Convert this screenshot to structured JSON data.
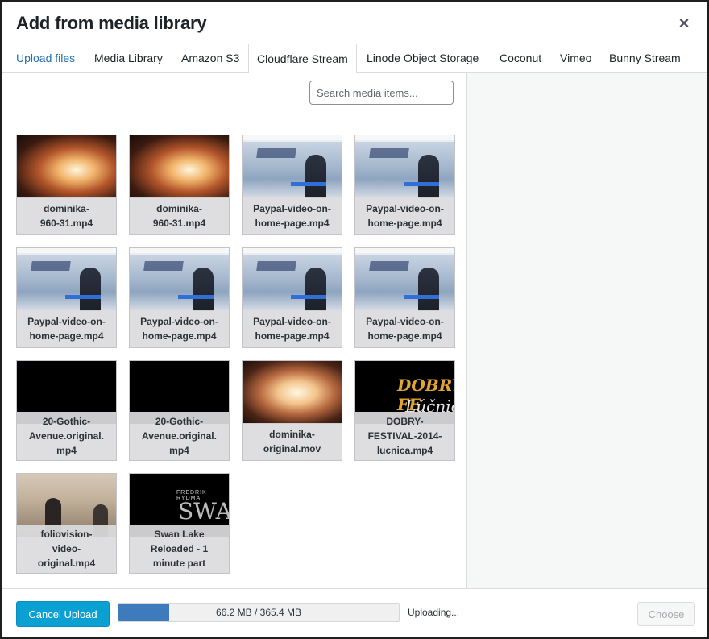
{
  "modal": {
    "title": "Add from media library",
    "close_label": "×"
  },
  "tabs": [
    {
      "label": "Upload files",
      "kind": "link"
    },
    {
      "label": "Media Library"
    },
    {
      "label": "Amazon S3"
    },
    {
      "label": "Cloudflare Stream",
      "active": true
    },
    {
      "label": "Linode Object Storage"
    },
    {
      "label": "Coconut"
    },
    {
      "label": "Vimeo"
    },
    {
      "label": "Bunny Stream"
    }
  ],
  "search": {
    "placeholder": "Search media items..."
  },
  "media_items": [
    {
      "lines": [
        "dominika-",
        "960-31.mp4"
      ],
      "thumb": "fire"
    },
    {
      "lines": [
        "dominika-",
        "960-31.mp4"
      ],
      "thumb": "fire"
    },
    {
      "lines": [
        "Paypal-video-on-",
        "home-page.mp4"
      ],
      "thumb": "site"
    },
    {
      "lines": [
        "Paypal-video-on-",
        "home-page.mp4"
      ],
      "thumb": "site"
    },
    {
      "lines": [
        "Paypal-video-on-",
        "home-page.mp4"
      ],
      "thumb": "site"
    },
    {
      "lines": [
        "Paypal-video-on-",
        "home-page.mp4"
      ],
      "thumb": "site"
    },
    {
      "lines": [
        "Paypal-video-on-",
        "home-page.mp4"
      ],
      "thumb": "site"
    },
    {
      "lines": [
        "Paypal-video-on-",
        "home-page.mp4"
      ],
      "thumb": "site"
    },
    {
      "lines": [
        "20-Gothic-",
        "Avenue.original.",
        "mp4"
      ],
      "thumb": "black"
    },
    {
      "lines": [
        "20-Gothic-",
        "Avenue.original.",
        "mp4"
      ],
      "thumb": "black"
    },
    {
      "lines": [
        "dominika-",
        "original.mov"
      ],
      "thumb": "fire2"
    },
    {
      "lines": [
        "DOBRY-",
        "FESTIVAL-2014-",
        "lucnica.mp4"
      ],
      "thumb": "dobry"
    },
    {
      "lines": [
        "foliovision-",
        "video-",
        "original.mp4"
      ],
      "thumb": "folio"
    },
    {
      "lines": [
        "Swan Lake",
        "Reloaded - 1",
        "minute part"
      ],
      "thumb": "swan"
    }
  ],
  "thumb_text": {
    "dobry_top": "DOBRY FE",
    "dobry_bottom": "Lúčnic",
    "swan_small": "FREDRIK RYDMA",
    "swan_big": "SWAN"
  },
  "footer": {
    "cancel_label": "Cancel Upload",
    "progress_text": "66.2 MB / 365.4 MB",
    "progress_fraction": 0.181,
    "status_text": "Uploading...",
    "choose_label": "Choose"
  },
  "colors": {
    "accent": "#0ba0d2",
    "link": "#2271b1",
    "progress": "#3d7bbd"
  }
}
